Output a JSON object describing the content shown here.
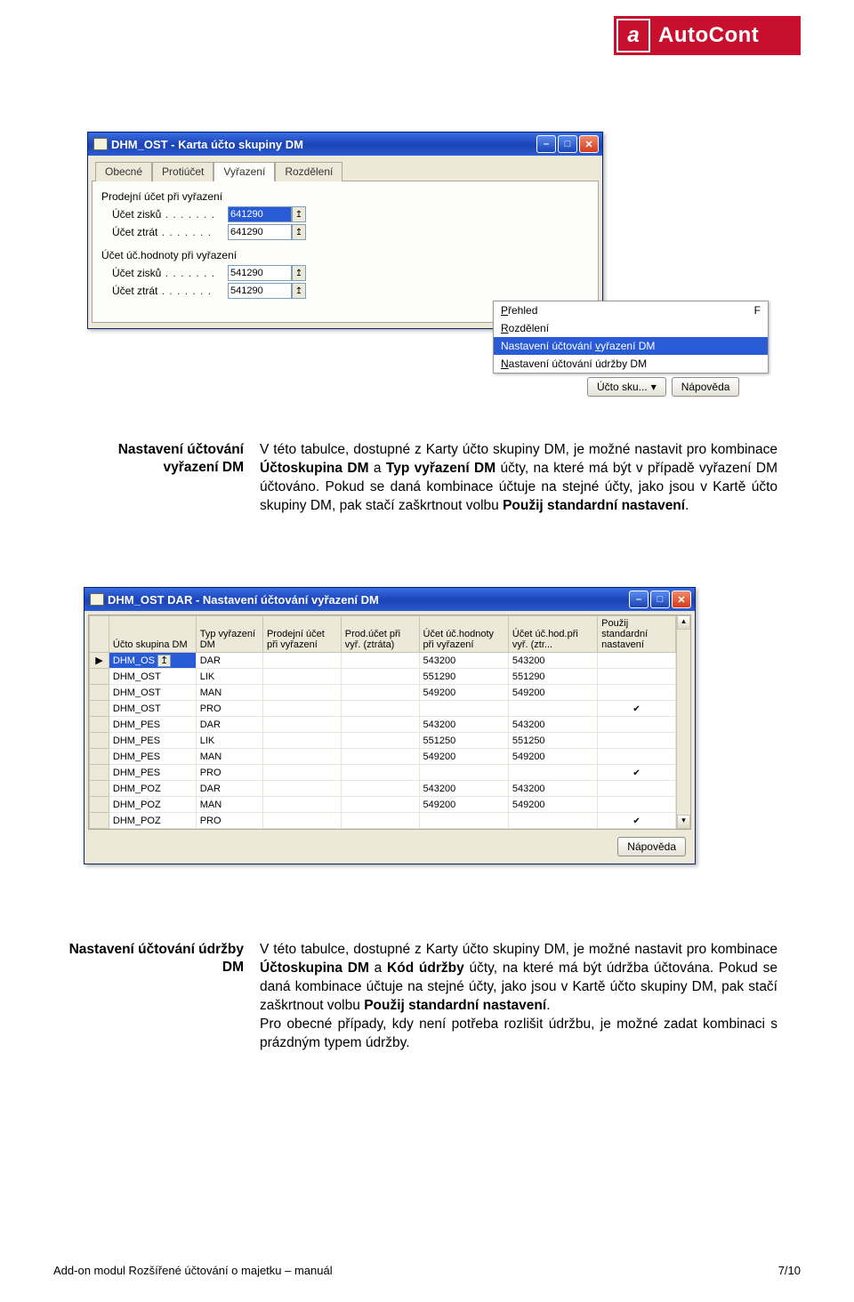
{
  "brand": {
    "icon": "a",
    "name": "AutoCont"
  },
  "win1": {
    "title": "DHM_OST - Karta účto skupiny DM",
    "tabs": [
      "Obecné",
      "Protiúčet",
      "Vyřazení",
      "Rozdělení"
    ],
    "activeTab": 2,
    "group1": "Prodejní účet při vyřazení",
    "group2": "Účet úč.hodnoty při vyřazení",
    "row_gain": "Účet zisků",
    "row_loss": "Účet ztrát",
    "field1": "641290",
    "field2": "641290",
    "field3": "541290",
    "field4": "541290",
    "popup": {
      "items": [
        "Přehled",
        "Rozdělení",
        "Nastavení účtování vyřazení DM",
        "Nastavení účtování údržby DM"
      ],
      "selected": 2,
      "ul": [
        "P",
        "R",
        "v",
        "N"
      ],
      "trailing": "F"
    },
    "btn_skupina": "Účto sku...",
    "btn_help": "Nápověda"
  },
  "para1": {
    "heading": "Nastavení účtování vyřazení DM",
    "text_a": "V této tabulce, dostupné z Karty účto skupiny DM, je možné nastavit pro kombinace ",
    "b1": "Účtoskupina DM",
    "mid1": " a ",
    "b2": "Typ vyřazení DM",
    "text_b": " účty, na které má být v případě vyřazení DM účtováno. Pokud se daná kombinace účtuje na stejné účty, jako jsou v Kartě účto skupiny DM, pak stačí zaškrtnout volbu ",
    "b3": "Použij standardní nastavení",
    "text_c": "."
  },
  "win2": {
    "title": "DHM_OST DAR - Nastavení účtování vyřazení DM",
    "headers": [
      "Účto skupina DM",
      "Typ vyřazení DM",
      "Prodejní účet při vyřazení",
      "Prod.účet při vyř. (ztráta)",
      "Účet úč.hodnoty při vyřazení",
      "Účet úč.hod.při vyř. (ztr...",
      "Použij standardní nastavení"
    ],
    "rows": [
      {
        "ind": "▶",
        "c0": "DHM_OS",
        "c1": "DAR",
        "c2": "",
        "c3": "",
        "c4": "543200",
        "c5": "543200",
        "chk": false,
        "sel": true
      },
      {
        "ind": "",
        "c0": "DHM_OST",
        "c1": "LIK",
        "c2": "",
        "c3": "",
        "c4": "551290",
        "c5": "551290",
        "chk": false
      },
      {
        "ind": "",
        "c0": "DHM_OST",
        "c1": "MAN",
        "c2": "",
        "c3": "",
        "c4": "549200",
        "c5": "549200",
        "chk": false
      },
      {
        "ind": "",
        "c0": "DHM_OST",
        "c1": "PRO",
        "c2": "",
        "c3": "",
        "c4": "",
        "c5": "",
        "chk": true
      },
      {
        "ind": "",
        "c0": "DHM_PES",
        "c1": "DAR",
        "c2": "",
        "c3": "",
        "c4": "543200",
        "c5": "543200",
        "chk": false
      },
      {
        "ind": "",
        "c0": "DHM_PES",
        "c1": "LIK",
        "c2": "",
        "c3": "",
        "c4": "551250",
        "c5": "551250",
        "chk": false
      },
      {
        "ind": "",
        "c0": "DHM_PES",
        "c1": "MAN",
        "c2": "",
        "c3": "",
        "c4": "549200",
        "c5": "549200",
        "chk": false
      },
      {
        "ind": "",
        "c0": "DHM_PES",
        "c1": "PRO",
        "c2": "",
        "c3": "",
        "c4": "",
        "c5": "",
        "chk": true
      },
      {
        "ind": "",
        "c0": "DHM_POZ",
        "c1": "DAR",
        "c2": "",
        "c3": "",
        "c4": "543200",
        "c5": "543200",
        "chk": false
      },
      {
        "ind": "",
        "c0": "DHM_POZ",
        "c1": "MAN",
        "c2": "",
        "c3": "",
        "c4": "549200",
        "c5": "549200",
        "chk": false
      },
      {
        "ind": "",
        "c0": "DHM_POZ",
        "c1": "PRO",
        "c2": "",
        "c3": "",
        "c4": "",
        "c5": "",
        "chk": true
      }
    ],
    "btn_help": "Nápověda"
  },
  "para2": {
    "heading": "Nastavení účtování údržby DM",
    "text_a": "V této tabulce, dostupné z Karty účto skupiny DM,  je možné nastavit pro kombinace ",
    "b1": "Účtoskupina DM",
    "mid1": " a ",
    "b2": "Kód údržby",
    "text_b": " účty, na které má být údržba účtována. Pokud se daná kombinace účtuje na stejné účty, jako jsou v Kartě účto skupiny DM, pak stačí zaškrtnout volbu ",
    "b3": "Použij standardní nastavení",
    "text_c": ".",
    "text_d": "Pro obecné případy, kdy není potřeba rozlišit údržbu, je možné zadat kombinaci s prázdným typem údržby."
  },
  "footer": {
    "left": "Add-on modul Rozšířené účtování o majetku – manuál",
    "right": "7/10"
  }
}
